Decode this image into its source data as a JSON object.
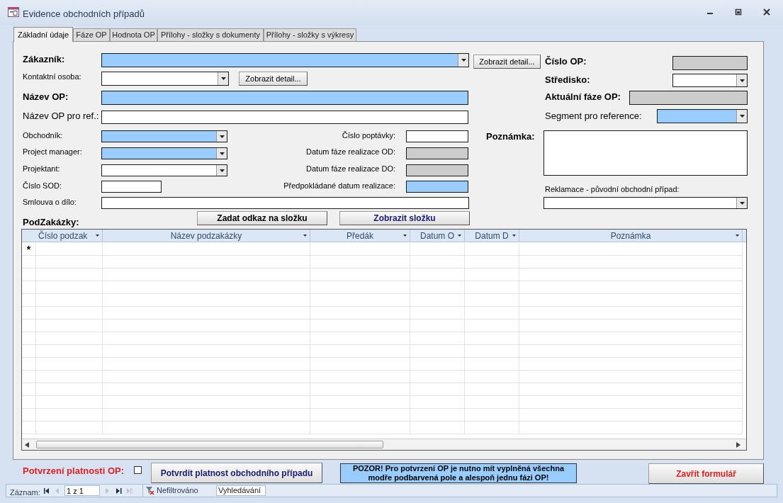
{
  "window": {
    "title": "Evidence obchodních případů"
  },
  "tabs": [
    {
      "label": "Základní údaje",
      "selected": true
    },
    {
      "label": "Fáze OP",
      "selected": false
    },
    {
      "label": "Hodnota OP",
      "selected": false
    },
    {
      "label": "Přílohy - složky s dokumenty",
      "selected": false
    },
    {
      "label": "Přílohy - složky s výkresy",
      "selected": false
    }
  ],
  "fields": [
    {
      "label": "Zákazník:",
      "bold": true,
      "kind": "combo",
      "required": true,
      "locked": false
    },
    {
      "label": "Kontaktní osoba:",
      "bold": false,
      "kind": "combo",
      "required": false,
      "locked": false
    },
    {
      "label": "Název OP:",
      "bold": true,
      "kind": "text",
      "required": true,
      "locked": false
    },
    {
      "label": "Název OP pro ref.:",
      "bold": false,
      "kind": "text",
      "required": false,
      "locked": false
    },
    {
      "label": "Obchodník:",
      "bold": false,
      "kind": "combo",
      "required": true,
      "locked": false
    },
    {
      "label": "Project manager:",
      "bold": false,
      "kind": "combo",
      "required": true,
      "locked": false
    },
    {
      "label": "Projektant:",
      "bold": false,
      "kind": "combo",
      "required": false,
      "locked": false
    },
    {
      "label": "Číslo SOD:",
      "bold": false,
      "kind": "text",
      "required": false,
      "locked": false
    },
    {
      "label": "Smlouva o dílo:",
      "bold": false,
      "kind": "text",
      "required": false,
      "locked": false
    },
    {
      "label": "Číslo poptávky:",
      "bold": false,
      "kind": "text",
      "required": false,
      "locked": false
    },
    {
      "label": "Datum fáze realizace OD:",
      "bold": false,
      "kind": "text",
      "required": false,
      "locked": true
    },
    {
      "label": "Datum fáze realizace DO:",
      "bold": false,
      "kind": "text",
      "required": false,
      "locked": true
    },
    {
      "label": "Předpokládané datum realizace:",
      "bold": false,
      "kind": "text",
      "required": true,
      "locked": false
    },
    {
      "label": "Číslo OP:",
      "bold": true,
      "kind": "text",
      "required": false,
      "locked": true
    },
    {
      "label": "Středisko:",
      "bold": true,
      "kind": "combo",
      "required": false,
      "locked": false
    },
    {
      "label": "Aktuální fáze OP:",
      "bold": true,
      "kind": "text",
      "required": false,
      "locked": true
    },
    {
      "label": "Segment pro reference:",
      "bold": false,
      "kind": "combo",
      "required": true,
      "locked": false
    },
    {
      "label": "Poznámka:",
      "bold": true,
      "kind": "memo",
      "required": false,
      "locked": false
    },
    {
      "label": "Reklamace - původní obchodní případ:",
      "bold": false,
      "kind": "combo",
      "required": false,
      "locked": false
    }
  ],
  "buttons": [
    "Zobrazit detail...",
    "Zobrazit detail...",
    "Zadat odkaz na složku",
    "Zobrazit složku"
  ],
  "subform": {
    "title": "PodZakázky:",
    "columns": [
      "Číslo podzak",
      "Název podzakázky",
      "Předák",
      "Datum O",
      "Datum D",
      "Poznámka"
    ],
    "new_row_marker": "*"
  },
  "footer": {
    "confirm_label": "Potvrzení platnosti OP:",
    "confirm_checked": false,
    "confirm_button": "Potvrdit platnost obchodního případu",
    "warning": "POZOR! Pro potvrzení OP je nutno mít vyplněná všechna modře podbarvená pole a alespoň jednu fázi OP!",
    "close_button": "Zavřít formulář"
  },
  "navigation": {
    "label": "Záznam:",
    "record": "1 z 1",
    "filter": "Nefiltrováno",
    "search_placeholder": "Vyhledávání"
  }
}
